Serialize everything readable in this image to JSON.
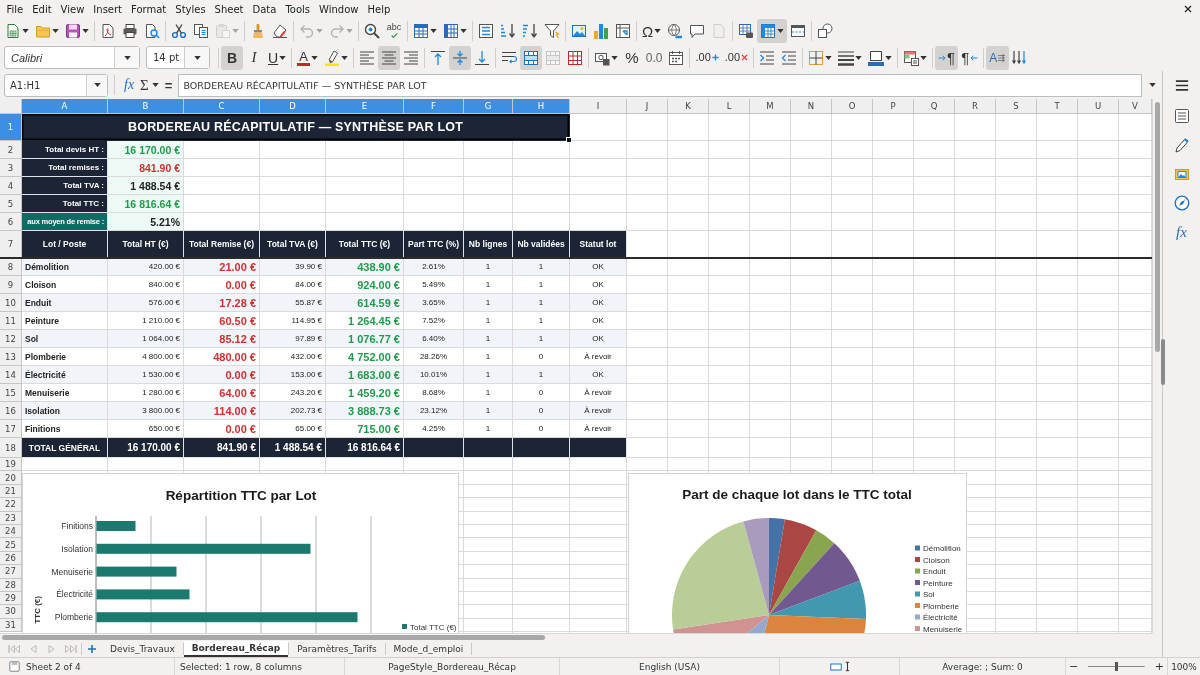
{
  "menu": [
    "File",
    "Edit",
    "View",
    "Insert",
    "Format",
    "Styles",
    "Sheet",
    "Data",
    "Tools",
    "Window",
    "Help"
  ],
  "toolbar_standard": [
    [
      {
        "kind": "new",
        "pressed": false,
        "disabled": false,
        "dropdown": true
      },
      {
        "kind": "open",
        "pressed": false,
        "disabled": false,
        "dropdown": true
      },
      {
        "kind": "save",
        "pressed": false,
        "disabled": false,
        "dropdown": true
      }
    ],
    [
      {
        "kind": "pdf",
        "pressed": false,
        "disabled": false,
        "dropdown": false
      },
      {
        "kind": "print",
        "pressed": false,
        "disabled": false,
        "dropdown": false
      },
      {
        "kind": "preview",
        "pressed": false,
        "disabled": false,
        "dropdown": false
      }
    ],
    [
      {
        "kind": "cut",
        "pressed": false,
        "disabled": false,
        "dropdown": false
      },
      {
        "kind": "copy",
        "pressed": false,
        "disabled": false,
        "dropdown": false
      },
      {
        "kind": "paste",
        "pressed": false,
        "disabled": true,
        "dropdown": true
      }
    ],
    [
      {
        "kind": "clone_formatting",
        "pressed": false,
        "disabled": false,
        "dropdown": false
      },
      {
        "kind": "clear_formatting",
        "pressed": false,
        "disabled": false,
        "dropdown": false
      }
    ],
    [
      {
        "kind": "undo",
        "pressed": false,
        "disabled": true,
        "dropdown": true
      },
      {
        "kind": "redo",
        "pressed": false,
        "disabled": true,
        "dropdown": true
      }
    ],
    [
      {
        "kind": "find_replace",
        "pressed": false,
        "disabled": false,
        "dropdown": false
      },
      {
        "kind": "spelling",
        "glyph": "abc",
        "pressed": false,
        "disabled": false,
        "dropdown": false
      }
    ],
    [
      {
        "kind": "rows",
        "pressed": false,
        "disabled": false,
        "dropdown": true
      },
      {
        "kind": "columns",
        "pressed": false,
        "disabled": false,
        "dropdown": true
      }
    ],
    [
      {
        "kind": "sort",
        "pressed": false,
        "disabled": false,
        "dropdown": false
      },
      {
        "kind": "sort_ascending",
        "pressed": false,
        "disabled": false,
        "dropdown": false
      },
      {
        "kind": "sort_descending",
        "pressed": false,
        "disabled": false,
        "dropdown": false
      },
      {
        "kind": "autofilter",
        "pressed": false,
        "disabled": false,
        "dropdown": false
      }
    ],
    [
      {
        "kind": "image",
        "pressed": false,
        "disabled": false,
        "dropdown": false
      },
      {
        "kind": "chart",
        "pressed": false,
        "disabled": false,
        "dropdown": false
      },
      {
        "kind": "pivot_table",
        "pressed": false,
        "disabled": false,
        "dropdown": false
      }
    ],
    [
      {
        "kind": "special_character",
        "glyph": "Ω",
        "pressed": false,
        "disabled": false,
        "dropdown": true
      },
      {
        "kind": "hyperlink",
        "pressed": false,
        "disabled": false,
        "dropdown": false
      },
      {
        "kind": "comment",
        "pressed": false,
        "disabled": false,
        "dropdown": false
      },
      {
        "kind": "header_footer",
        "pressed": false,
        "disabled": true,
        "dropdown": false
      }
    ],
    [
      {
        "kind": "print_area",
        "pressed": false,
        "disabled": false,
        "dropdown": false
      },
      {
        "kind": "freeze",
        "pressed": true,
        "disabled": false,
        "dropdown": true
      },
      {
        "kind": "split_window",
        "pressed": false,
        "disabled": false,
        "dropdown": false
      }
    ],
    [
      {
        "kind": "draw",
        "pressed": false,
        "disabled": false,
        "dropdown": false
      }
    ]
  ],
  "toolbar_formatting": {
    "font_name": "Calibri",
    "font_size": "14 pt",
    "groups": [
      [
        {
          "kind": "bold",
          "glyph": "B",
          "pressed": true,
          "disabled": false,
          "dropdown": false
        },
        {
          "kind": "italic",
          "glyph": "I",
          "pressed": false,
          "disabled": false,
          "dropdown": false
        },
        {
          "kind": "underline",
          "glyph": "U",
          "pressed": false,
          "disabled": false,
          "dropdown": true
        }
      ],
      [
        {
          "kind": "font_color",
          "glyph": "A",
          "pressed": false,
          "disabled": false,
          "dropdown": true
        },
        {
          "kind": "highlight",
          "pressed": false,
          "disabled": false,
          "dropdown": true
        }
      ],
      [
        {
          "kind": "align_left",
          "pressed": false,
          "disabled": false,
          "dropdown": false
        },
        {
          "kind": "align_center",
          "pressed": true,
          "disabled": false,
          "dropdown": false
        },
        {
          "kind": "align_right",
          "pressed": false,
          "disabled": false,
          "dropdown": false
        }
      ],
      [
        {
          "kind": "align_top",
          "pressed": false,
          "disabled": false,
          "dropdown": false
        },
        {
          "kind": "align_middle",
          "pressed": true,
          "disabled": false,
          "dropdown": false
        },
        {
          "kind": "align_bottom",
          "pressed": false,
          "disabled": false,
          "dropdown": false
        }
      ],
      [
        {
          "kind": "wrap",
          "pressed": false,
          "disabled": false,
          "dropdown": false
        },
        {
          "kind": "merge_center",
          "pressed": true,
          "disabled": false,
          "dropdown": false
        },
        {
          "kind": "merge",
          "pressed": false,
          "disabled": true,
          "dropdown": false
        },
        {
          "kind": "unmerge",
          "pressed": false,
          "disabled": false,
          "dropdown": false
        }
      ],
      [
        {
          "kind": "currency",
          "pressed": false,
          "disabled": false,
          "dropdown": true
        },
        {
          "kind": "percent",
          "glyph": "%",
          "pressed": false,
          "disabled": false,
          "dropdown": false
        },
        {
          "kind": "decimal",
          "glyph": "0.0",
          "pressed": false,
          "disabled": false,
          "dropdown": false
        },
        {
          "kind": "date",
          "pressed": false,
          "disabled": false,
          "dropdown": false
        }
      ],
      [
        {
          "kind": "add_decimal",
          "glyph": ".00",
          "pressed": false,
          "disabled": false,
          "dropdown": false
        },
        {
          "kind": "delete_decimal",
          "glyph": ".00",
          "pressed": false,
          "disabled": false,
          "dropdown": false
        }
      ],
      [
        {
          "kind": "indent",
          "pressed": false,
          "disabled": false,
          "dropdown": false
        },
        {
          "kind": "outdent",
          "pressed": false,
          "disabled": false,
          "dropdown": false
        }
      ],
      [
        {
          "kind": "borders",
          "pressed": false,
          "disabled": false,
          "dropdown": true
        },
        {
          "kind": "border_style",
          "pressed": false,
          "disabled": false,
          "dropdown": true
        },
        {
          "kind": "border_color",
          "pressed": false,
          "disabled": false,
          "dropdown": true
        }
      ],
      [
        {
          "kind": "conditional",
          "pressed": false,
          "disabled": false,
          "dropdown": true
        }
      ],
      [
        {
          "kind": "ltr",
          "glyph": "¶",
          "pressed": true,
          "disabled": false,
          "dropdown": false
        },
        {
          "kind": "rtl",
          "glyph": "¶",
          "pressed": false,
          "disabled": false,
          "dropdown": false
        }
      ],
      [
        {
          "kind": "text_ltr",
          "glyph": "A",
          "pressed": true,
          "disabled": false,
          "dropdown": false
        },
        {
          "kind": "text_vertical",
          "pressed": false,
          "disabled": false,
          "dropdown": false
        }
      ]
    ]
  },
  "formula_bar": {
    "name_box": "A1:H1",
    "function_wizard": "fx",
    "sum": "Σ",
    "equals": "=",
    "value": "BORDEREAU RÉCAPITULATIF — SYNTHÈSE PAR LOT"
  },
  "sidebar": [
    {
      "kind": "properties"
    },
    {
      "kind": "styles"
    },
    {
      "kind": "gallery"
    },
    {
      "kind": "navigator"
    },
    {
      "kind": "functions",
      "glyph": "fx"
    }
  ],
  "sheet": {
    "column_headers": [
      {
        "label": "A",
        "selected": true
      },
      {
        "label": "B",
        "selected": true
      },
      {
        "label": "C",
        "selected": true
      },
      {
        "label": "D",
        "selected": true
      },
      {
        "label": "E",
        "selected": true
      },
      {
        "label": "F",
        "selected": true
      },
      {
        "label": "G",
        "selected": true
      },
      {
        "label": "H",
        "selected": true
      },
      {
        "label": "I",
        "selected": false
      },
      {
        "label": "J",
        "selected": false
      },
      {
        "label": "K",
        "selected": false
      },
      {
        "label": "L",
        "selected": false
      },
      {
        "label": "M",
        "selected": false
      },
      {
        "label": "N",
        "selected": false
      },
      {
        "label": "O",
        "selected": false
      },
      {
        "label": "P",
        "selected": false
      },
      {
        "label": "Q",
        "selected": false
      },
      {
        "label": "R",
        "selected": false
      },
      {
        "label": "S",
        "selected": false
      },
      {
        "label": "T",
        "selected": false
      },
      {
        "label": "U",
        "selected": false
      },
      {
        "label": "V",
        "selected": false
      }
    ],
    "row_headers": [
      {
        "label": "1",
        "selected": true
      },
      {
        "label": "2",
        "selected": false
      },
      {
        "label": "3",
        "selected": false
      },
      {
        "label": "4",
        "selected": false
      },
      {
        "label": "5",
        "selected": false
      },
      {
        "label": "6",
        "selected": false
      },
      {
        "label": "7",
        "selected": false
      },
      {
        "label": "8",
        "selected": false
      },
      {
        "label": "9",
        "selected": false
      },
      {
        "label": "10",
        "selected": false
      },
      {
        "label": "11",
        "selected": false
      },
      {
        "label": "12",
        "selected": false
      },
      {
        "label": "13",
        "selected": false
      },
      {
        "label": "14",
        "selected": false
      },
      {
        "label": "15",
        "selected": false
      },
      {
        "label": "16",
        "selected": false
      },
      {
        "label": "17",
        "selected": false
      },
      {
        "label": "18",
        "selected": false
      },
      {
        "label": "19",
        "selected": false
      },
      {
        "label": "20",
        "selected": false
      },
      {
        "label": "21",
        "selected": false
      },
      {
        "label": "22",
        "selected": false
      },
      {
        "label": "23",
        "selected": false
      },
      {
        "label": "24",
        "selected": false
      },
      {
        "label": "25",
        "selected": false
      },
      {
        "label": "26",
        "selected": false
      },
      {
        "label": "27",
        "selected": false
      },
      {
        "label": "28",
        "selected": false
      },
      {
        "label": "29",
        "selected": false
      },
      {
        "label": "30",
        "selected": false
      },
      {
        "label": "31",
        "selected": false
      }
    ],
    "title": {
      "text": "BORDEREAU RÉCAPITULATIF — SYNTHÈSE PAR LOT",
      "selected": true
    },
    "summary": [
      {
        "label": "Total devis HT :",
        "value": "16 170.00 €",
        "color": "#1f9d4b",
        "highlighted": false
      },
      {
        "label": "Total remises :",
        "value": "841.90 €",
        "color": "#d32f2f",
        "highlighted": false
      },
      {
        "label": "Total TVA :",
        "value": "1 488.54 €",
        "color": "#222222",
        "highlighted": false
      },
      {
        "label": "Total TTC :",
        "value": "16 816.64 €",
        "color": "#1f9d4b",
        "highlighted": false
      },
      {
        "label": "aux moyen de remise :",
        "value": "5.21%",
        "color": "#222222",
        "highlighted": true
      }
    ],
    "table": {
      "headers": [
        "Lot / Poste",
        "Total HT (€)",
        "Total Remise (€)",
        "Total TVA (€)",
        "Total TTC (€)",
        "Part TTC (%)",
        "Nb lignes",
        "Nb validées",
        "Statut lot"
      ],
      "rows": [
        [
          "Démolition",
          "420.00 €",
          "21.00 €",
          "39.90 €",
          "438.90 €",
          "2.61%",
          "1",
          "1",
          "OK"
        ],
        [
          "Cloison",
          "840.00 €",
          "0.00 €",
          "84.00 €",
          "924.00 €",
          "5.49%",
          "1",
          "1",
          "OK"
        ],
        [
          "Enduit",
          "576.00 €",
          "17.28 €",
          "55.87 €",
          "614.59 €",
          "3.65%",
          "1",
          "1",
          "OK"
        ],
        [
          "Peinture",
          "1 210.00 €",
          "60.50 €",
          "114.95 €",
          "1 264.45 €",
          "7.52%",
          "1",
          "1",
          "OK"
        ],
        [
          "Sol",
          "1 064.00 €",
          "85.12 €",
          "97.89 €",
          "1 076.77 €",
          "6.40%",
          "1",
          "1",
          "OK"
        ],
        [
          "Plomberie",
          "4 800.00 €",
          "480.00 €",
          "432.00 €",
          "4 752.00 €",
          "28.26%",
          "1",
          "0",
          "À revoir"
        ],
        [
          "Électricité",
          "1 530.00 €",
          "0.00 €",
          "153.00 €",
          "1 683.00 €",
          "10.01%",
          "1",
          "1",
          "OK"
        ],
        [
          "Menuiserie",
          "1 280.00 €",
          "64.00 €",
          "243.20 €",
          "1 459.20 €",
          "8.68%",
          "1",
          "0",
          "À revoir"
        ],
        [
          "Isolation",
          "3 800.00 €",
          "114.00 €",
          "202.73 €",
          "3 888.73 €",
          "23.12%",
          "1",
          "0",
          "À revoir"
        ],
        [
          "Finitions",
          "650.00 €",
          "0.00 €",
          "65.00 €",
          "715.00 €",
          "4.25%",
          "1",
          "0",
          "À revoir"
        ]
      ],
      "total": {
        "label": "TOTAL GÉNÉRAL",
        "values": [
          "16 170.00 €",
          "841.90 €",
          "1 488.54 €",
          "16 816.64 €"
        ]
      }
    }
  },
  "bar_chart": {
    "title": "Répartition TTC par Lot",
    "category_labels": [
      "Finitions",
      "Isolation",
      "Menuiserie",
      "Électricité",
      "Plomberie"
    ],
    "axis_title": "TTC (€)",
    "legend": "Total TTC (€)"
  },
  "pie_chart": {
    "title": "Part de chaque lot dans le TTC total",
    "legend": [
      {
        "label": "Démolition",
        "color": "#4572a7"
      },
      {
        "label": "Cloison",
        "color": "#aa4643"
      },
      {
        "label": "Enduit",
        "color": "#89a54e"
      },
      {
        "label": "Peinture",
        "color": "#71588f"
      },
      {
        "label": "Sol",
        "color": "#4198af"
      },
      {
        "label": "Plomberie",
        "color": "#db843d"
      },
      {
        "label": "Électricité",
        "color": "#93a9cf"
      },
      {
        "label": "Menuiserie",
        "color": "#d19392"
      }
    ]
  },
  "sheet_tab_nav": [
    {
      "kind": "first",
      "disabled": true
    },
    {
      "kind": "previous",
      "disabled": true
    },
    {
      "kind": "next",
      "disabled": true
    },
    {
      "kind": "last",
      "disabled": true
    }
  ],
  "sheet_tabs": [
    {
      "label": "Devis_Travaux",
      "selected": false
    },
    {
      "label": "Bordereau_Récap",
      "selected": true
    },
    {
      "label": "Paramètres_Tarifs",
      "selected": false
    },
    {
      "label": "Mode_d_emploi",
      "selected": false
    }
  ],
  "status_bar": {
    "sheet": "Sheet 2 of 4",
    "selection": "Selected: 1 row, 8 columns",
    "page_style": "PageStyle_Bordereau_Récap",
    "language": "English (USA)",
    "statistics": "Average: ; Sum: 0",
    "zoom": {
      "minus": "−",
      "plus": "+",
      "level": 0.5,
      "percent": "100%"
    }
  }
}
